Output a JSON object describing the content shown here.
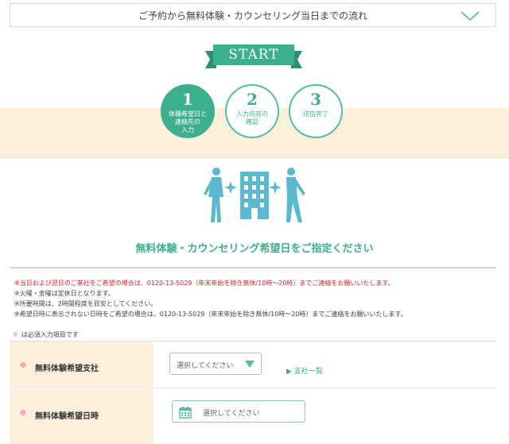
{
  "accordion": {
    "title": "ご予約から無料体験・カウンセリング当日までの流れ"
  },
  "ribbon": {
    "label": "START"
  },
  "steps": [
    {
      "number": "1",
      "label": "体験希望日と\n連絡先の\n入力"
    },
    {
      "number": "2",
      "label": "入力内容の\n確認"
    },
    {
      "number": "3",
      "label": "送信完了"
    }
  ],
  "section": {
    "heading": "無料体験・カウンセリング希望日をご指定ください"
  },
  "notes": {
    "line1": "※当日および翌日のご来社をご希望の場合は、0120-13-5029（年末年始を除き無休/10時〜20時）までご連絡をお願いいたします。",
    "line2": "※火曜・金曜は定休日となります。",
    "line3": "※所要時間は、2時間程度を目安としてください。",
    "line4": "※希望日時に表示されない日時をご希望の場合は、0120-13-5029（年末年始を除き無休/10時〜20時）までご連絡をお願いいたします。"
  },
  "required_note": {
    "star": "※",
    "text": "は必須入力項目です"
  },
  "form": {
    "branch": {
      "label": "無料体験希望支社",
      "placeholder": "選択してください",
      "link": "▶ 支社一覧"
    },
    "datetime": {
      "label": "無料体験希望日時",
      "placeholder": "選択してください"
    }
  },
  "colors": {
    "accent": "#3cb08c",
    "band": "#fcefdc",
    "required": "#e8799c",
    "alert": "#e0262b"
  }
}
